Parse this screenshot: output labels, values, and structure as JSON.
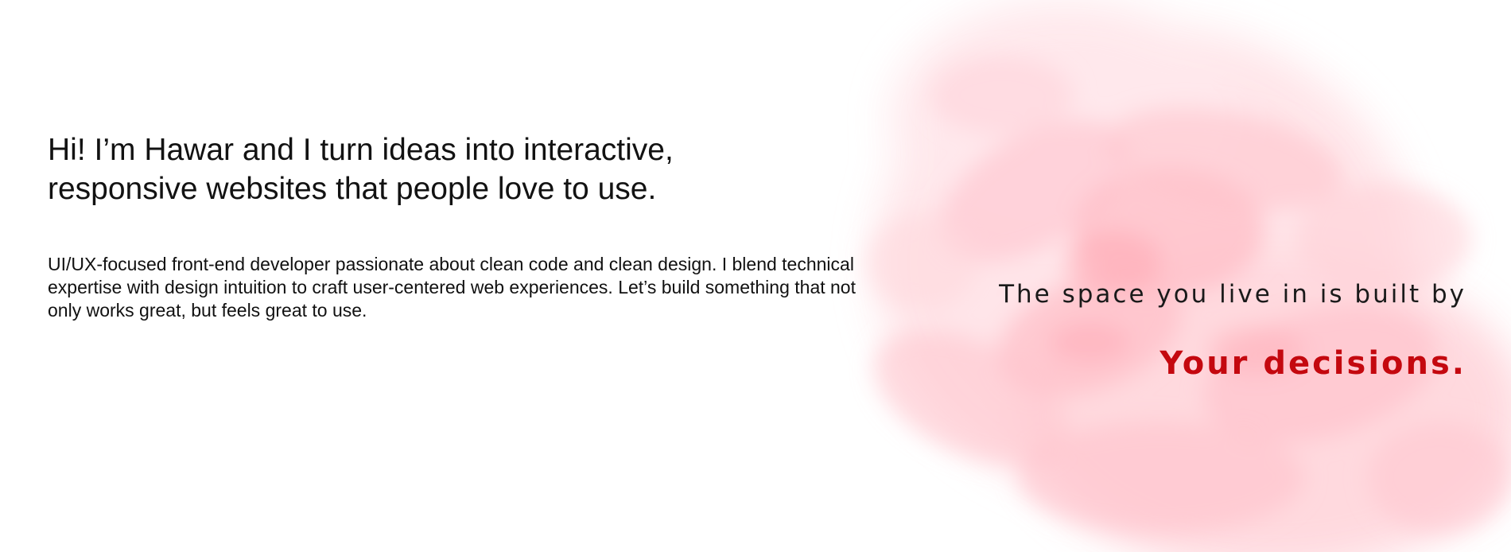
{
  "hero": {
    "headline": "Hi! I’m Hawar and I turn ideas into interactive, responsive websites that people love to use.",
    "description": "UI/UX-focused front-end developer passionate about clean code and clean design. I blend technical expertise with design intuition to craft user-centered web experiences. Let’s build something that not only works great, but feels great to use."
  },
  "quote": {
    "line": "The space you live in is built by",
    "emphasis": "Your decisions."
  },
  "colors": {
    "accent": "#c4080f",
    "watercolor": "#ffb3bd",
    "text": "#111111",
    "background": "#ffffff"
  }
}
